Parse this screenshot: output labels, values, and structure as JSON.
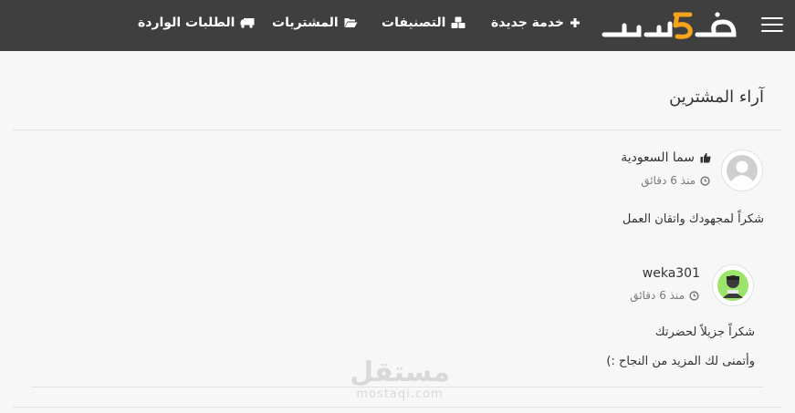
{
  "header": {
    "logo_text": "خمسات",
    "nav": [
      {
        "label": "خدمة جديدة",
        "icon": "plus-icon"
      },
      {
        "label": "التصنيفات",
        "icon": "cubes-icon"
      },
      {
        "label": "المشتريات",
        "icon": "folder-open-icon"
      },
      {
        "label": "الطلبات الواردة",
        "icon": "truck-icon"
      }
    ]
  },
  "section": {
    "title": "آراء المشترين"
  },
  "reviews": [
    {
      "user": "سما السعودية",
      "time": "منذ 6 دقائق",
      "lines": [
        "شكراً لمجهودك واتقان العمل"
      ]
    },
    {
      "user": "weka301",
      "time": "منذ 6 دقائق",
      "lines": [
        "شكراً جزيلاً لحضرتك",
        "وأتمنى لك المزيد من النجاح :)"
      ]
    }
  ],
  "watermark": {
    "arabic": "مستقل",
    "latin": "mostaqi.com"
  },
  "colors": {
    "header_bg": "#3f3f3f",
    "page_bg": "#f7f7f7",
    "logo_accent": "#f5a31a"
  }
}
